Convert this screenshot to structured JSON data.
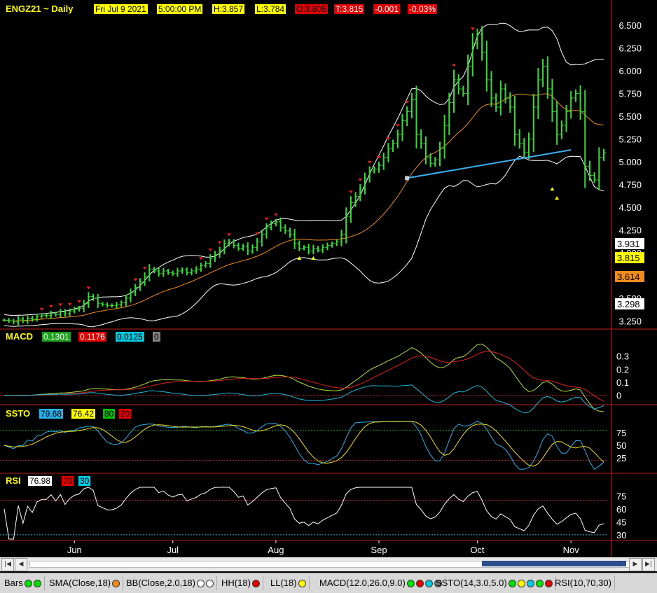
{
  "header": {
    "symbol": "ENGZ21 ~ Daily",
    "date": "Fri Jul 9 2021",
    "time": "5:00:00 PM",
    "high": "H:3.857",
    "low": "L:3.784",
    "open": "O:3.805",
    "close": "T:3.815",
    "change": "-0.001",
    "change_pct": "-0.03%"
  },
  "price_axis": {
    "ticks": [
      "6.500",
      "6.250",
      "6.000",
      "5.750",
      "5.500",
      "5.250",
      "5.000",
      "4.750",
      "4.500",
      "4.250",
      "4.000",
      "3.750",
      "3.500",
      "3.250"
    ],
    "tags": [
      {
        "label": "3.931",
        "color": "#ffffff",
        "text_color": "#000000"
      },
      {
        "label": "3.815",
        "color": "#ffff00",
        "text_color": "#000000"
      },
      {
        "label": "3.614",
        "color": "#f08c1e",
        "text_color": "#000000"
      },
      {
        "label": "3.298",
        "color": "#ffffff",
        "text_color": "#000000"
      }
    ]
  },
  "macd_header": {
    "title": "MACD",
    "v1": "0.1301",
    "v2": "0.1176",
    "v3": "0.0125",
    "v4": "0"
  },
  "macd_ticks": [
    "0.3",
    "0.2",
    "0.1",
    "0"
  ],
  "ssto_header": {
    "title": "SSTO",
    "v1": "79.68",
    "v2": "76.42",
    "v3": "80",
    "v4": "20"
  },
  "ssto_ticks": [
    "75",
    "50",
    "25"
  ],
  "rsi_header": {
    "title": "RSI",
    "v1": "76.98",
    "v2": "70",
    "v3": "30"
  },
  "rsi_ticks": [
    "75",
    "60",
    "45",
    "30"
  ],
  "time_axis": [
    "Jun",
    "Jul",
    "Aug",
    "Sep",
    "Oct",
    "Nov"
  ],
  "statusbar": [
    {
      "label": "Bars",
      "dots": [
        "#00e000",
        "#00e000"
      ]
    },
    {
      "label": "SMA(Close,18)",
      "dots": [
        "#f08c1e"
      ]
    },
    {
      "label": "BB(Close,2.0,18)",
      "dots": [
        "#ffffff",
        "#ffffff"
      ]
    },
    {
      "label": "HH(18)",
      "dots": [
        "#e00000"
      ]
    },
    {
      "label": "LL(18)",
      "dots": [
        "#ffff00"
      ]
    },
    {
      "label": "MACD(12.0,26.0,9.0)",
      "dots": [
        "#00e000",
        "#e00000",
        "#00c8e0",
        "#808080"
      ]
    },
    {
      "label": "SSTO(14,3.0,5.0)",
      "dots": [
        "#00e000",
        "#ffff00",
        "#00c8e0",
        "#00e000",
        "#e00000"
      ]
    },
    {
      "label": "RSI(10,70,30)",
      "dots": []
    }
  ],
  "colors": {
    "bars": "#33dd33",
    "sma": "#f08c1e",
    "bb": "#ffffff",
    "trendline": "#3ab0f0",
    "macd": "#b0e040",
    "signal": "#e02020",
    "hist": "#20b8d8",
    "stoch_k": "#2ab0e8",
    "stoch_d": "#f0e020",
    "rsi": "#ffffff",
    "grid_red": "#c02020"
  },
  "chart_data": {
    "type": "line",
    "title": "ENGZ21 ~ Daily",
    "price": {
      "n_bars": 122,
      "closes": [
        3.26,
        3.25,
        3.24,
        3.27,
        3.25,
        3.28,
        3.27,
        3.3,
        3.31,
        3.31,
        3.33,
        3.32,
        3.35,
        3.33,
        3.36,
        3.38,
        3.39,
        3.44,
        3.52,
        3.5,
        3.44,
        3.43,
        3.42,
        3.42,
        3.43,
        3.45,
        3.5,
        3.56,
        3.62,
        3.68,
        3.74,
        3.82,
        3.8,
        3.77,
        3.8,
        3.78,
        3.77,
        3.8,
        3.81,
        3.78,
        3.8,
        3.82,
        3.86,
        3.88,
        3.94,
        3.98,
        4.03,
        4.1,
        4.12,
        4.08,
        4.05,
        4.07,
        4.02,
        4.06,
        4.12,
        4.2,
        4.28,
        4.32,
        4.34,
        4.28,
        4.24,
        4.2,
        4.1,
        4.05,
        4.06,
        4.02,
        4.05,
        4.03,
        4.06,
        4.08,
        4.1,
        4.12,
        4.2,
        4.4,
        4.55,
        4.62,
        4.7,
        4.82,
        4.9,
        4.92,
        4.96,
        5.05,
        5.15,
        5.2,
        5.3,
        5.45,
        5.55,
        5.68,
        5.3,
        5.2,
        5.05,
        4.98,
        5.02,
        5.15,
        5.4,
        5.65,
        5.9,
        5.8,
        5.75,
        6.05,
        6.3,
        6.4,
        6.2,
        5.9,
        5.7,
        5.6,
        5.8,
        5.7,
        5.6,
        5.3,
        5.2,
        5.1,
        5.25,
        5.6,
        5.9,
        6.05,
        5.8,
        5.55,
        5.3,
        5.4,
        5.55,
        5.7,
        5.75,
        5.55,
        4.95,
        4.85,
        4.8,
        5.05,
        5.1
      ],
      "ylim": [
        3.2,
        6.7
      ]
    },
    "macd_ylim": [
      -0.05,
      0.4
    ],
    "ssto_ylim": [
      0,
      100
    ],
    "rsi_ylim": [
      25,
      85
    ],
    "trendline": {
      "from_price": 4.82,
      "to_price": 5.13
    }
  }
}
